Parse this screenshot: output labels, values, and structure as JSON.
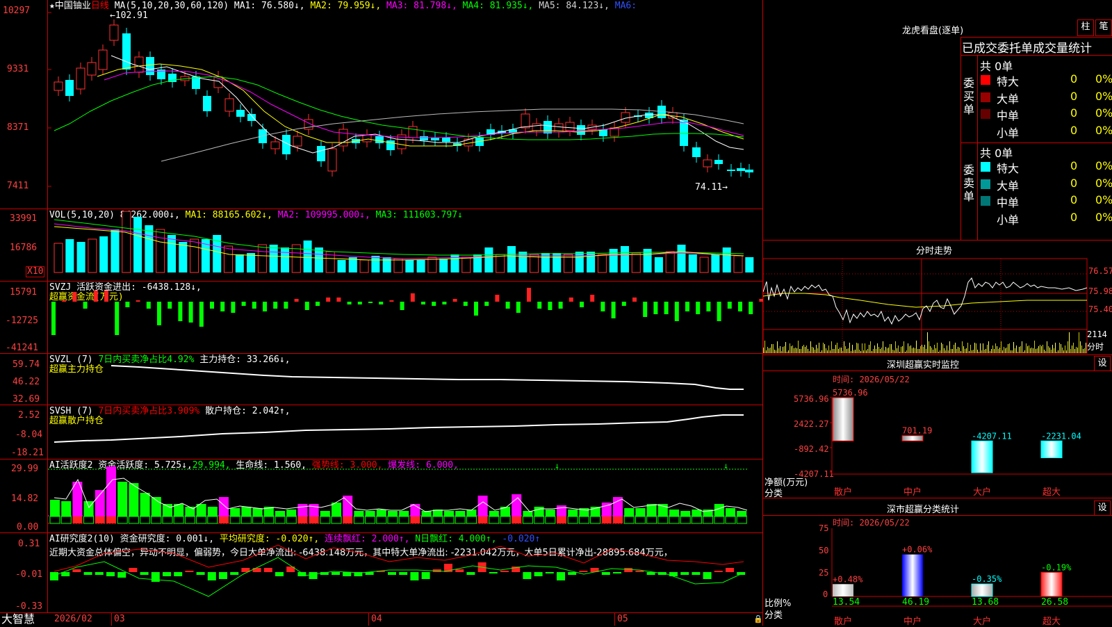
{
  "main": {
    "y_labels": [
      "10297",
      "9331",
      "8371",
      "7411"
    ],
    "title": {
      "star": "★",
      "stock": "中国铀业",
      "period": "日线",
      "ma_label": "MA(5,10,20,30,60,120)",
      "ma1": "MA1: 76.580↓,",
      "ma2": "MA2: 79.959↓,",
      "ma3": "MA3: 81.798↓,",
      "ma4": "MA4: 81.935↓,",
      "ma5": "MA5: 84.123↓,",
      "ma6": "MA6:"
    },
    "high_marker": "102.91",
    "low_marker": "74.11→"
  },
  "vol": {
    "y_labels": [
      "33991",
      "16786"
    ],
    "unit": "X10",
    "title": {
      "label": "VOL(5,10,20)",
      "value": "84262.000↓,",
      "ma1": "MA1: 88165.602↓,",
      "ma2": "MA2: 109995.000↓,",
      "ma3": "MA3: 111603.797↓"
    }
  },
  "svzj": {
    "y_labels": [
      "15791",
      "-12725",
      "-41241"
    ],
    "line1": "SVZJ  活跃资金进出: -6438.128↓,",
    "line2": "超赢资金流(万元)"
  },
  "svzl": {
    "y_labels": [
      "59.74",
      "46.22",
      "32.69"
    ],
    "label": "SVZL (7)",
    "pct": "7日内买卖净占比4.92%",
    "value": "主力持仓: 33.266↓,",
    "line2": "超赢主力持仓"
  },
  "svsh": {
    "y_labels": [
      "2.52",
      "-8.04",
      "-18.21"
    ],
    "label": "SVSH (7)",
    "pct": "7日内买卖净占比3.909%",
    "value": "散户持仓: 2.042↑,",
    "line2": "超赢散户持仓"
  },
  "ai1": {
    "y_labels": [
      "29.99",
      "14.82",
      "0.00"
    ],
    "label": "AI活跃度2",
    "a": "资金活跃度: 5.725↓,",
    "b": "29.994,",
    "c": "生命线: 1.560,",
    "d": "强势线: 3.000,",
    "e": "爆发线: 6.000,"
  },
  "ai2": {
    "y_labels": [
      "0.31",
      "-0.01",
      "-0.33"
    ],
    "label": "AI研究度2(10)",
    "a": "资金研究度: 0.001↓,",
    "b": "平均研究度: -0.020↑,",
    "c": "连续飘红: 2.000↑,",
    "d": "N日飘红: 4.000↑,",
    "e": "-0.020↑",
    "summary": "近期大资金总体偏空，异动不明显，偏弱势，今日大单净流出: -6438.148万元，其中特大单净流出: -2231.042万元，大单5日累计净出-28895.684万元，"
  },
  "xaxis": {
    "brand": "大智慧",
    "labels": [
      "2026/02",
      "03",
      "04",
      "05"
    ]
  },
  "dragon": {
    "title": "龙虎看盘(逐单)",
    "btn1": "柱",
    "btn2": "笔",
    "header": "已成交委托单成交量统计",
    "buy_label": "委买单",
    "sell_label": "委卖单",
    "buy_total": "共 0单",
    "sell_total": "共 0单",
    "buy_rows": [
      {
        "label": "特大",
        "count": "0",
        "pct": "0%",
        "color": "#ff0000"
      },
      {
        "label": "大单",
        "count": "0",
        "pct": "0%",
        "color": "#990000"
      },
      {
        "label": "中单",
        "count": "0",
        "pct": "0%",
        "color": "#660000"
      },
      {
        "label": "小单",
        "count": "0",
        "pct": "0%",
        "color": ""
      }
    ],
    "sell_rows": [
      {
        "label": "特大",
        "count": "0",
        "pct": "0%",
        "color": "#00ffff"
      },
      {
        "label": "大单",
        "count": "0",
        "pct": "0%",
        "color": "#009999"
      },
      {
        "label": "中单",
        "count": "0",
        "pct": "0%",
        "color": "#007777"
      },
      {
        "label": "小单",
        "count": "0",
        "pct": "0%",
        "color": ""
      }
    ]
  },
  "intraday": {
    "title": "分时走势",
    "right_labels": [
      "76.57",
      "75.98",
      "75.40"
    ],
    "vol_label": "2114",
    "unit_label": "分时"
  },
  "monitor": {
    "title": "深圳超赢实时监控",
    "btn": "设",
    "time": "时间: 2026/05/22",
    "y_labels": [
      "5736.96",
      "2422.27",
      "-892.42",
      "-4207.11"
    ],
    "y_title": "净额(万元)",
    "x_title": "分类",
    "categories": [
      "散户",
      "中户",
      "大户",
      "超大"
    ],
    "values": [
      "5736.96",
      "701.19",
      "-4207.11",
      "-2231.04"
    ]
  },
  "classify": {
    "title": "深市超赢分类统计",
    "btn": "设",
    "time": "时间: 2026/05/22",
    "y_labels": [
      "75",
      "50",
      "25",
      "0"
    ],
    "y_title": "比例%",
    "x_title": "分类",
    "categories": [
      "散户",
      "中户",
      "大户",
      "超大"
    ],
    "pct_changes": [
      "+0.48%",
      "+0.06%",
      "-0.35%",
      "-0.19%"
    ],
    "values": [
      "13.54",
      "46.19",
      "13.68",
      "26.58"
    ]
  }
}
